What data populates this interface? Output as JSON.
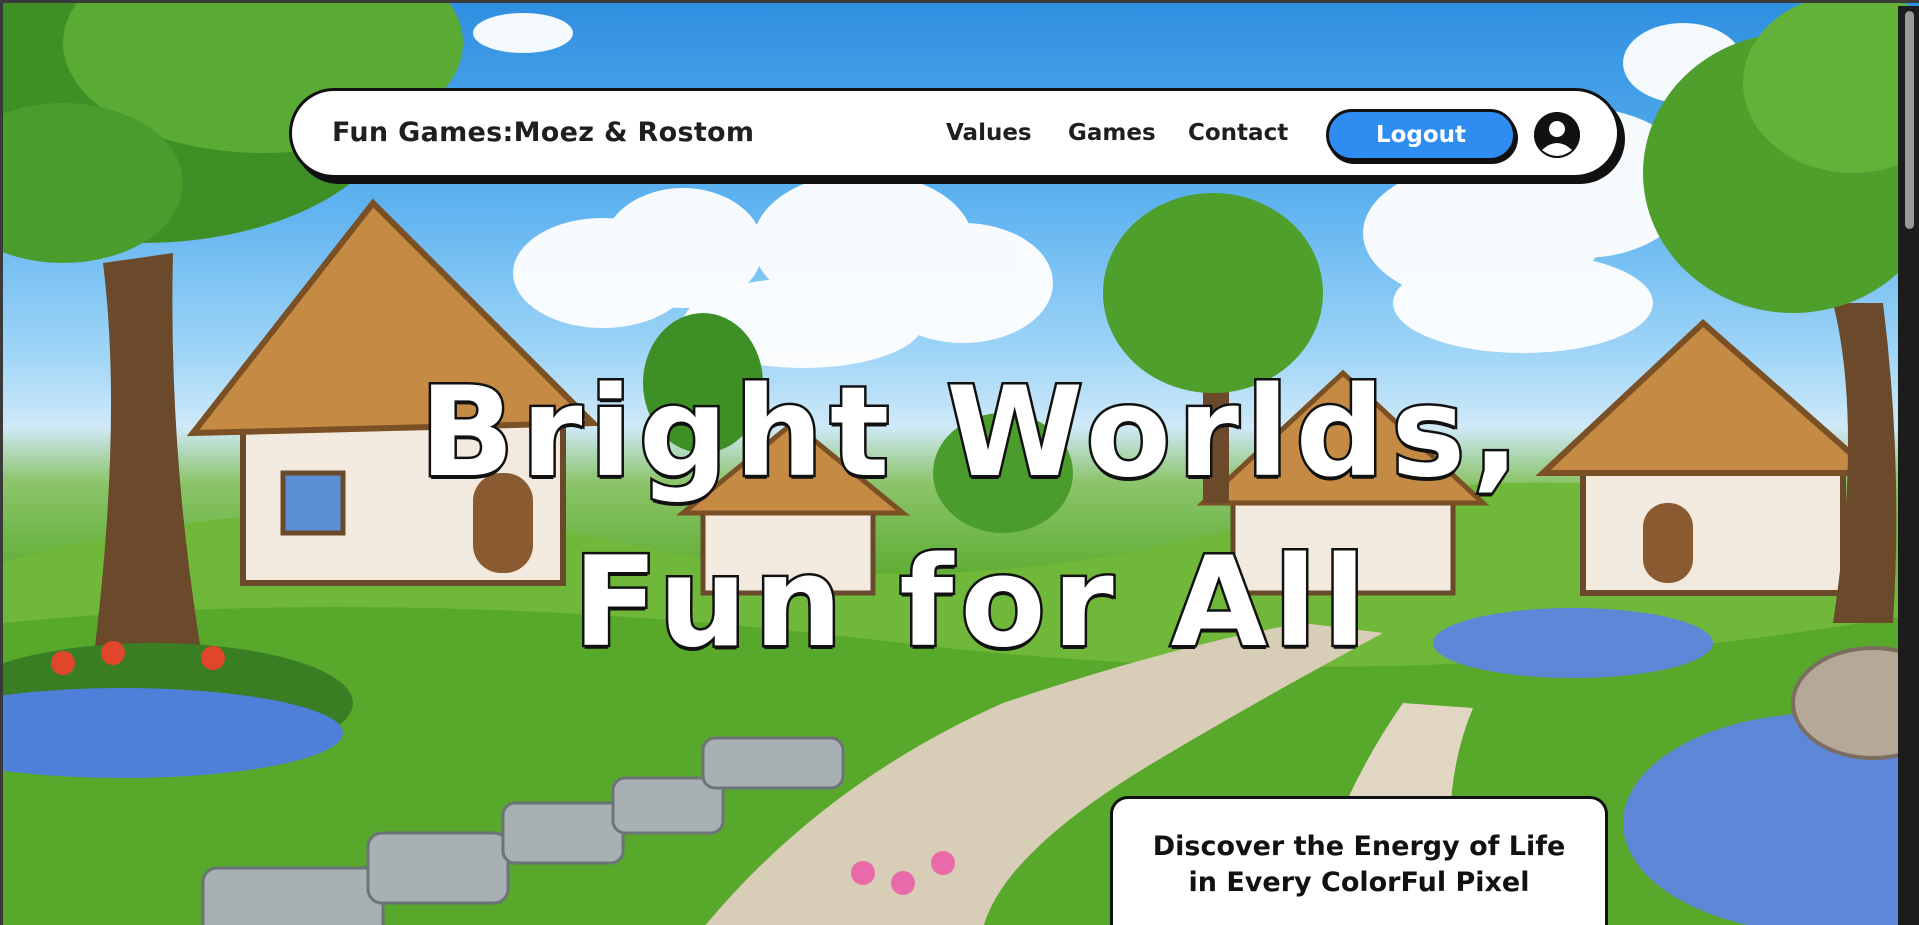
{
  "header": {
    "brand": "Fun Games:Moez & Rostom",
    "nav": [
      {
        "label": "Values"
      },
      {
        "label": "Games"
      },
      {
        "label": "Contact"
      }
    ],
    "logout_label": "Logout",
    "avatar_icon": "user-circle-icon"
  },
  "hero": {
    "line1": "Bright Worlds,",
    "line2": "Fun for All"
  },
  "tagline": {
    "line1": "Discover the Energy of Life",
    "line2": "in Every ColorFul Pixel"
  },
  "colors": {
    "accent": "#2f8cf0",
    "outline": "#111111",
    "header_bg": "#ffffff"
  },
  "background": {
    "description_icon": "fantasy-village-illustration"
  }
}
